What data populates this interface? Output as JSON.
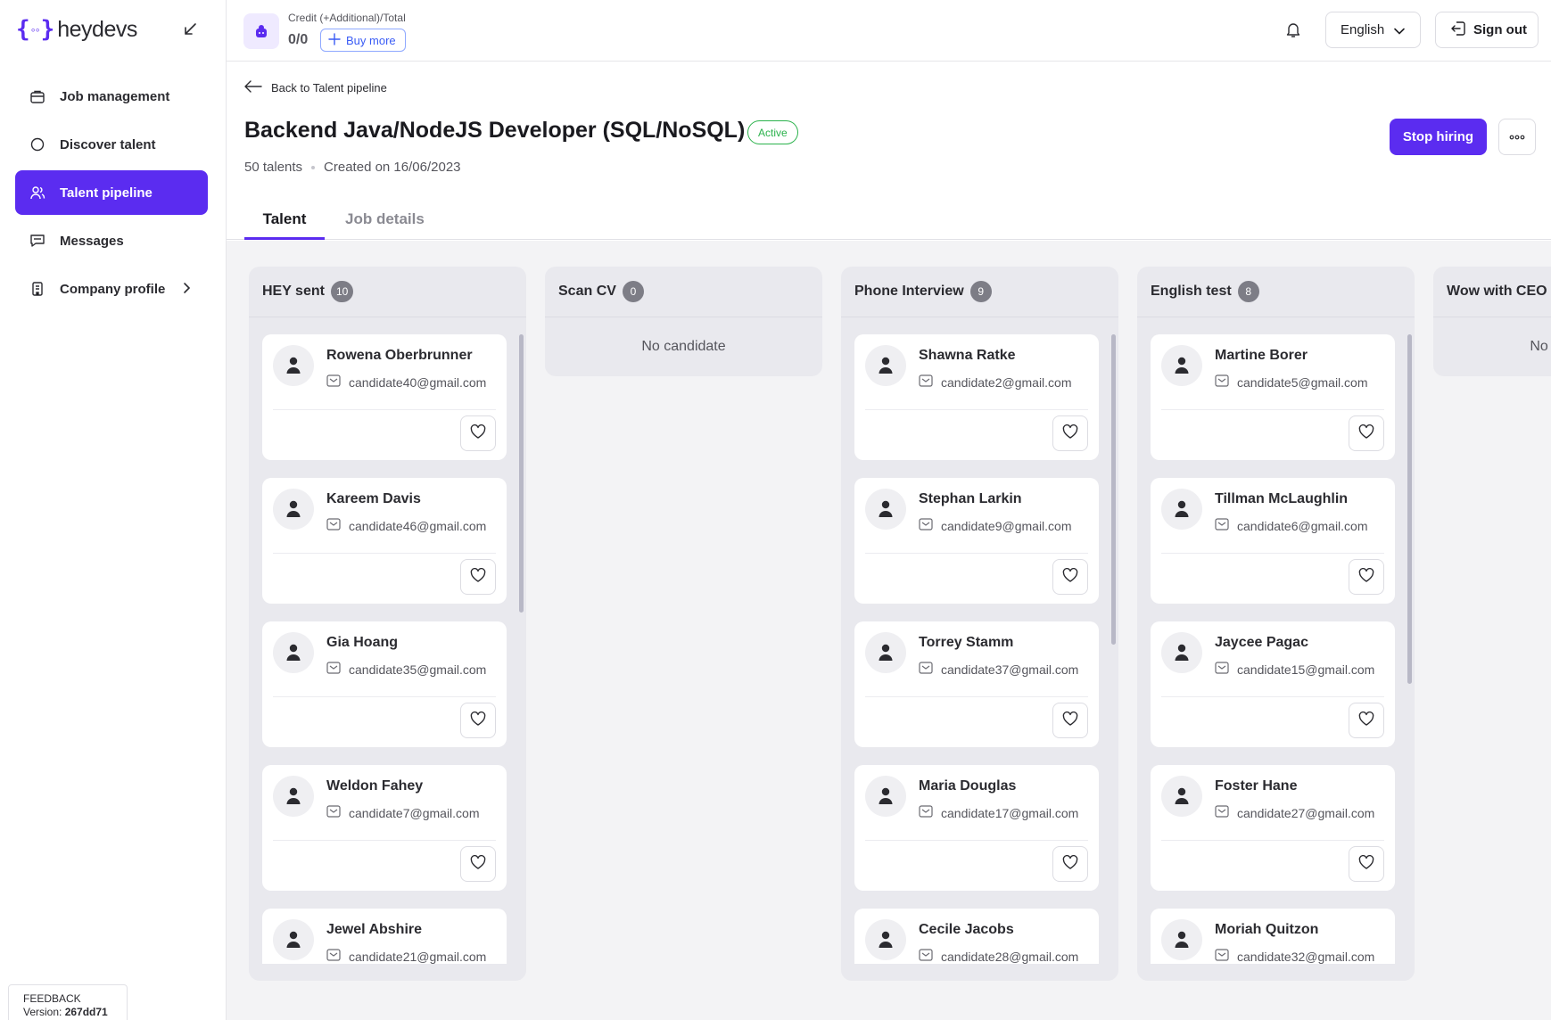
{
  "brand": {
    "name": "heydevs"
  },
  "sidebar": {
    "items": [
      {
        "label": "Job management",
        "icon": "briefcase-icon",
        "active": false
      },
      {
        "label": "Discover talent",
        "icon": "search-circle-icon",
        "active": false
      },
      {
        "label": "Talent pipeline",
        "icon": "users-icon",
        "active": true
      },
      {
        "label": "Messages",
        "icon": "message-icon",
        "active": false
      },
      {
        "label": "Company profile",
        "icon": "building-icon",
        "active": false,
        "has_submenu": true
      }
    ],
    "feedback": {
      "label": "FEEDBACK",
      "version_prefix": "Version:",
      "version": "267dd71"
    }
  },
  "topbar": {
    "credit_label": "Credit (+Additional)/Total",
    "credit_value": "0/0",
    "buy_more": "Buy more",
    "language": "English",
    "sign_out": "Sign out"
  },
  "job": {
    "back_label": "Back to Talent pipeline",
    "title": "Backend Java/NodeJS Developer (SQL/NoSQL)",
    "status": "Active",
    "talents": "50 talents",
    "created": "Created on 16/06/2023",
    "stop_hiring": "Stop hiring"
  },
  "tabs": [
    {
      "label": "Talent",
      "active": true
    },
    {
      "label": "Job details",
      "active": false
    }
  ],
  "columns": [
    {
      "title": "HEY sent",
      "count": "10",
      "candidates": [
        {
          "name": "Rowena Oberbrunner",
          "email": "candidate40@gmail.com"
        },
        {
          "name": "Kareem Davis",
          "email": "candidate46@gmail.com"
        },
        {
          "name": "Gia Hoang",
          "email": "candidate35@gmail.com"
        },
        {
          "name": "Weldon Fahey",
          "email": "candidate7@gmail.com"
        },
        {
          "name": "Jewel Abshire",
          "email": "candidate21@gmail.com"
        }
      ]
    },
    {
      "title": "Scan CV",
      "count": "0",
      "empty_text": "No candidate",
      "candidates": []
    },
    {
      "title": "Phone Interview",
      "count": "9",
      "candidates": [
        {
          "name": "Shawna Ratke",
          "email": "candidate2@gmail.com"
        },
        {
          "name": "Stephan Larkin",
          "email": "candidate9@gmail.com"
        },
        {
          "name": "Torrey Stamm",
          "email": "candidate37@gmail.com"
        },
        {
          "name": "Maria Douglas",
          "email": "candidate17@gmail.com"
        },
        {
          "name": "Cecile Jacobs",
          "email": "candidate28@gmail.com"
        }
      ]
    },
    {
      "title": "English test",
      "count": "8",
      "candidates": [
        {
          "name": "Martine Borer",
          "email": "candidate5@gmail.com"
        },
        {
          "name": "Tillman McLaughlin",
          "email": "candidate6@gmail.com"
        },
        {
          "name": "Jaycee Pagac",
          "email": "candidate15@gmail.com"
        },
        {
          "name": "Foster Hane",
          "email": "candidate27@gmail.com"
        },
        {
          "name": "Moriah Quitzon",
          "email": "candidate32@gmail.com"
        }
      ]
    },
    {
      "title": "Wow with CEO",
      "count": "",
      "empty_text": "No candidate",
      "candidates": []
    }
  ],
  "colors": {
    "accent": "#5b2cf0",
    "active_green": "#2bb24c",
    "board_bg": "#f3f3f5",
    "column_bg": "#e9e9ee"
  }
}
